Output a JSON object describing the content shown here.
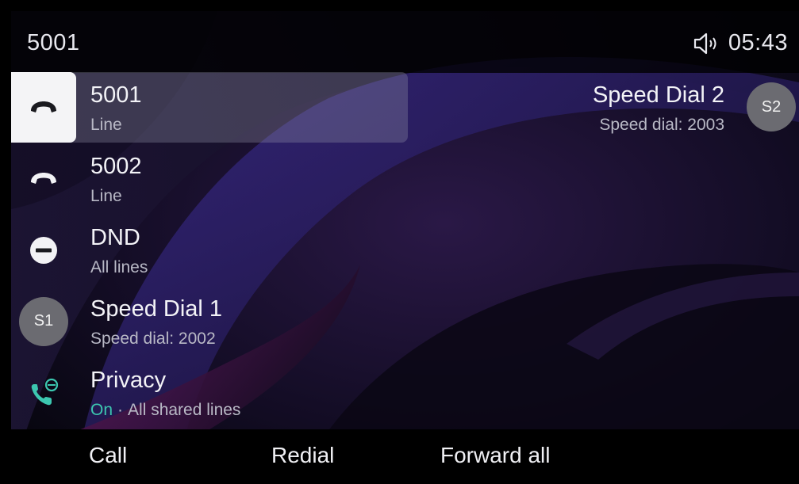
{
  "header": {
    "title": "5001",
    "time": "05:43",
    "status_icon": "speaker-icon"
  },
  "keys": [
    {
      "label": "5001",
      "sub": "Line",
      "icon": "handset-icon",
      "selected": true
    },
    {
      "label": "5002",
      "sub": "Line",
      "icon": "handset-icon",
      "selected": false
    },
    {
      "label": "DND",
      "sub": "All lines",
      "icon": "do-not-disturb-icon",
      "selected": false
    },
    {
      "label": "Speed Dial 1",
      "sub": "Speed dial: 2002",
      "avatar": "S1",
      "selected": false
    },
    {
      "label": "Privacy",
      "sub_state": "On",
      "sub_sep": "·",
      "sub": "All shared lines",
      "icon": "privacy-phone-icon",
      "selected": false
    }
  ],
  "speed_dial_right": {
    "label": "Speed Dial 2",
    "sub": "Speed dial: 2003",
    "avatar": "S2"
  },
  "softkeys": [
    {
      "label": "Call"
    },
    {
      "label": "Redial"
    },
    {
      "label": "Forward all"
    }
  ],
  "colors": {
    "accent_on": "#3cc7b0",
    "selected_bg": "#f4f4f6",
    "avatar_bg": "#6b6b71"
  }
}
